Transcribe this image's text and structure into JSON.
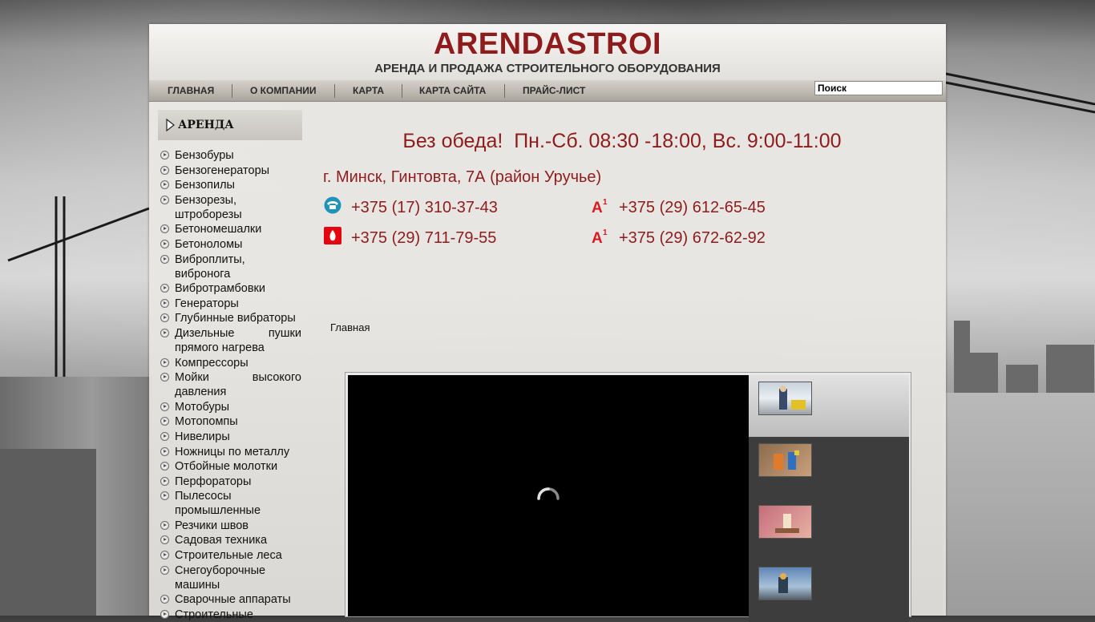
{
  "site": {
    "title": "ARENDASTROI",
    "subtitle": "АРЕНДА И ПРОДАЖА СТРОИТЕЛЬНОГО ОБОРУДОВАНИЯ"
  },
  "nav": {
    "items": [
      {
        "label": "ГЛАВНАЯ"
      },
      {
        "label": "О КОМПАНИИ"
      },
      {
        "label": "КАРТА"
      },
      {
        "label": "КАРТА САЙТА"
      },
      {
        "label": "ПРАЙС-ЛИСТ"
      }
    ],
    "search": {
      "value": "Поиск"
    }
  },
  "sidebar": {
    "title": "АРЕНДА",
    "items": [
      {
        "label": "Бензобуры"
      },
      {
        "label": "Бензогенераторы"
      },
      {
        "label": "Бензопилы"
      },
      {
        "label": "Бензорезы, штроборезы"
      },
      {
        "label": "Бетономешалки"
      },
      {
        "label": "Бетоноломы"
      },
      {
        "label": "Виброплиты, вибронога"
      },
      {
        "label": "Вибротрамбовки"
      },
      {
        "label": "Генераторы"
      },
      {
        "label": "Глубинные вибраторы"
      },
      {
        "label": "Дизельные пушки прямого нагрева"
      },
      {
        "label": "Компрессоры"
      },
      {
        "label": "Мойки высокого давления"
      },
      {
        "label": "Мотобуры"
      },
      {
        "label": "Мотопомпы"
      },
      {
        "label": "Нивелиры"
      },
      {
        "label": "Ножницы по металлу"
      },
      {
        "label": "Отбойные молотки"
      },
      {
        "label": "Перфораторы"
      },
      {
        "label": "Пылесосы промышленные"
      },
      {
        "label": "Резчики швов"
      },
      {
        "label": "Садовая техника"
      },
      {
        "label": "Строительные леса"
      },
      {
        "label": "Снегоуборочные машины"
      },
      {
        "label": "Сварочные аппараты"
      },
      {
        "label": "Строительные"
      }
    ]
  },
  "contact": {
    "hours": "Без обеда!  Пн.-Сб. 08:30 -18:00, Вс. 9:00-11:00",
    "address": "г. Минск, Гинтовта, 7А (район Уручье)",
    "phones": [
      {
        "icon": "landline-phone-icon",
        "number": "+375 (17) 310-37-43"
      },
      {
        "icon": "a1-operator-icon",
        "number": "+375 (29) 612-65-45"
      },
      {
        "icon": "mts-operator-icon",
        "number": "+375 (29) 711-79-55"
      },
      {
        "icon": "a1-operator-icon",
        "number": "+375 (29) 672-62-92"
      }
    ]
  },
  "breadcrumb": {
    "home": "Главная"
  },
  "colors": {
    "accent": "#8e1c1c",
    "page_bg": "#e8e6e2",
    "nav_bg": "#bdb8b0"
  }
}
